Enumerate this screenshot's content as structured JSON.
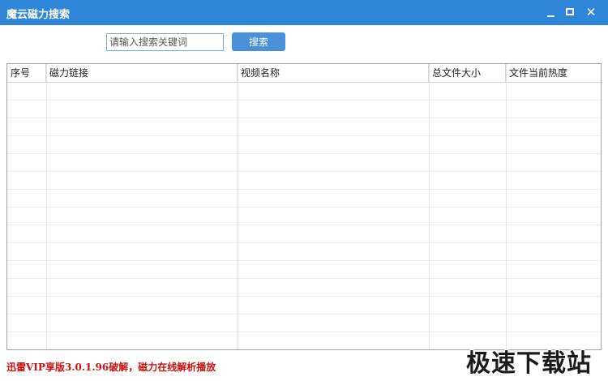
{
  "window": {
    "title": "魔云磁力搜索",
    "minimize_icon": "minimize-icon",
    "maximize_icon": "maximize-icon",
    "close_icon": "close-icon",
    "titlebar_color": "#2f86d9"
  },
  "search": {
    "placeholder": "请输入搜索关键词",
    "value": "",
    "button_label": "搜索"
  },
  "table": {
    "columns": [
      "序号",
      "磁力链接",
      "视频名称",
      "总文件大小",
      "文件当前热度"
    ],
    "rows": []
  },
  "status": {
    "text": "迅雷VIP享版3.0.1.96破解，磁力在线解析播放",
    "color": "#cc1010"
  },
  "watermark": {
    "text": "极速下载站"
  }
}
